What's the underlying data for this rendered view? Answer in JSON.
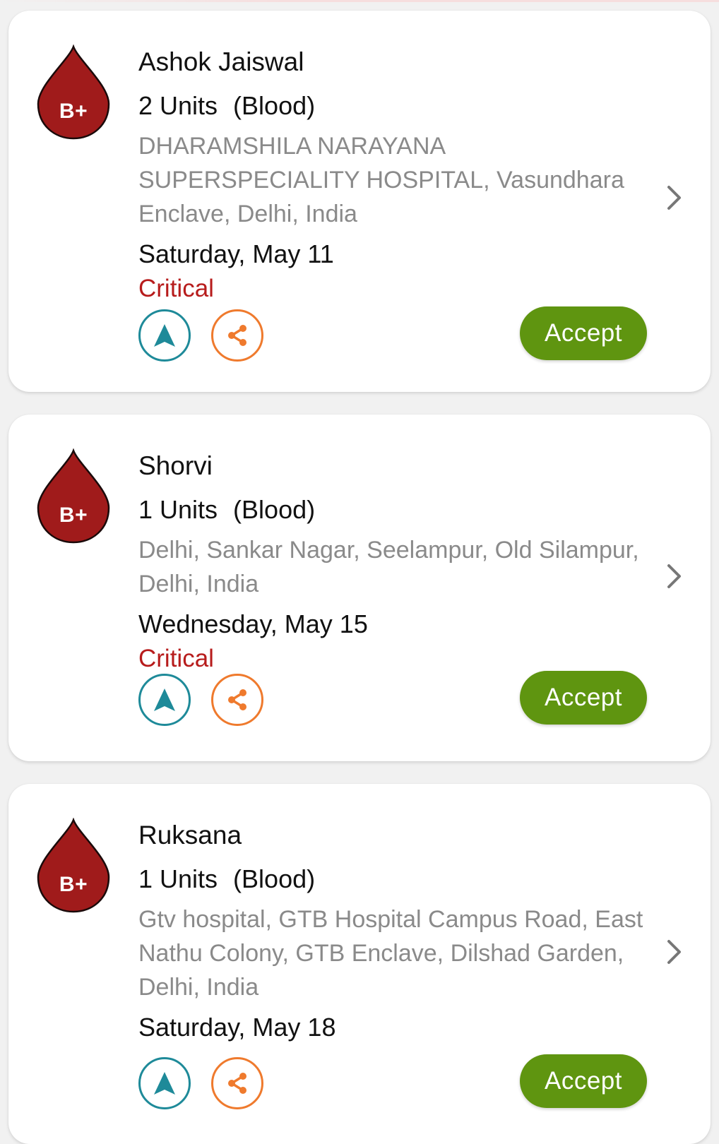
{
  "colors": {
    "drop": "#a01b1b",
    "critical": "#b71c1c",
    "accept": "#5f9510",
    "navigate": "#1e8a99",
    "share": "#ef7a2d"
  },
  "requests": [
    {
      "blood_group": "B+",
      "name": "Ashok Jaiswal",
      "units": "2 Units",
      "type": "(Blood)",
      "address": "DHARAMSHILA NARAYANA SUPERSPECIALITY HOSPITAL, Vasundhara Enclave, Delhi, India",
      "date": "Saturday, May 11",
      "status": "Critical",
      "accept_label": "Accept"
    },
    {
      "blood_group": "B+",
      "name": "Shorvi",
      "units": "1 Units",
      "type": "(Blood)",
      "address": "Delhi, Sankar Nagar, Seelampur, Old Silampur, Delhi, India",
      "date": "Wednesday, May 15",
      "status": "Critical",
      "accept_label": "Accept"
    },
    {
      "blood_group": "B+",
      "name": "Ruksana",
      "units": "1 Units",
      "type": "(Blood)",
      "address": "Gtv hospital, GTB Hospital Campus Road, East Nathu Colony, GTB Enclave, Dilshad Garden, Delhi, India",
      "date": "Saturday, May 18",
      "status": "",
      "accept_label": "Accept"
    }
  ],
  "icons": {
    "drop": "blood-drop-icon",
    "navigate": "navigation-arrow-icon",
    "share": "share-icon",
    "chevron": "chevron-right-icon"
  }
}
